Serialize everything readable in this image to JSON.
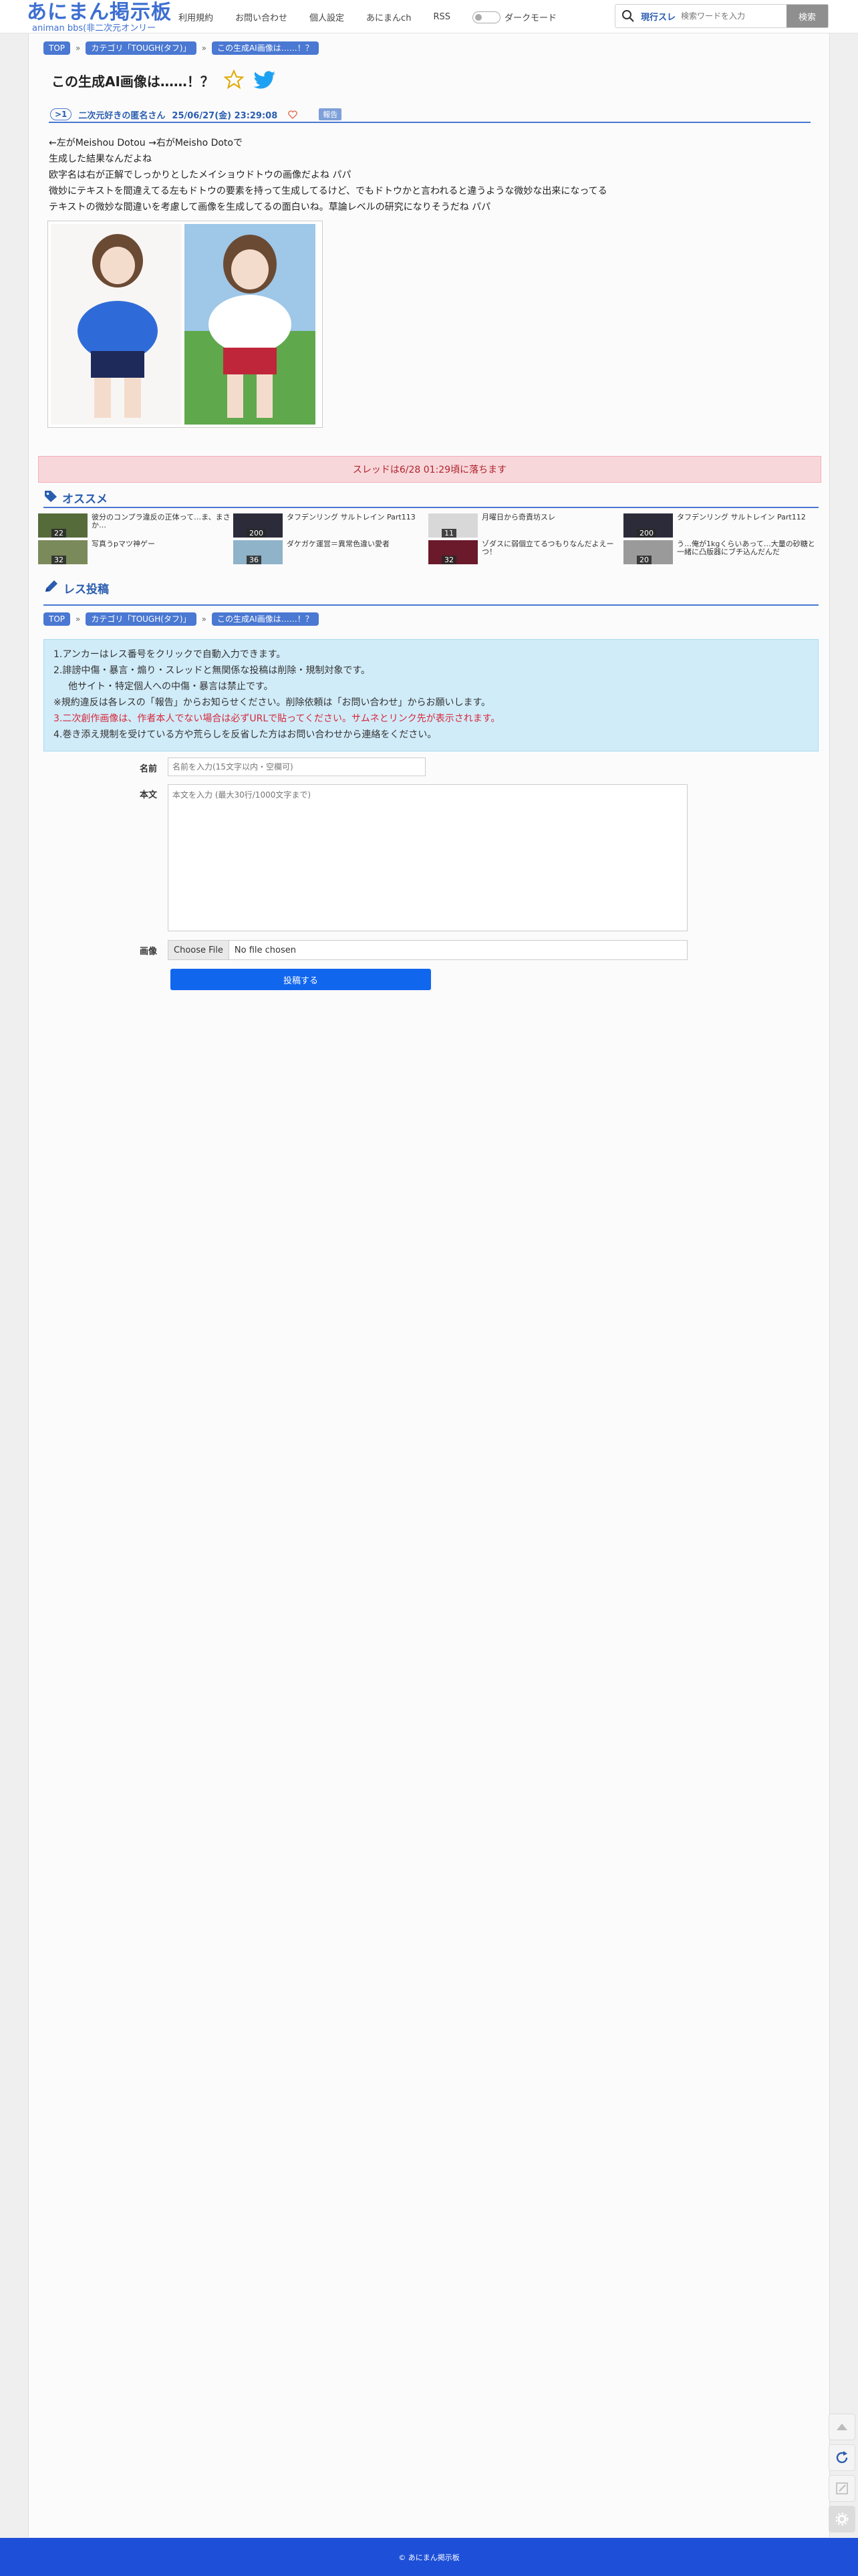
{
  "header": {
    "logo_main": "あにまん掲示板",
    "logo_sub": "animan bbs(非二次元オンリー",
    "nav": [
      "利用規約",
      "お問い合わせ",
      "個人設定",
      "あにまんch",
      "RSS"
    ],
    "dark_mode_label": "ダークモード",
    "search_scope": "現行スレ",
    "search_placeholder": "検索ワードを入力",
    "search_button": "検索"
  },
  "breadcrumb": [
    "TOP",
    "カテゴリ「TOUGH(タフ)」",
    "この生成AI画像は……！？"
  ],
  "thread": {
    "title": "この生成AI画像は……！？",
    "post": {
      "number": ">1",
      "poster": "二次元好きの匿名さん",
      "date": "25/06/27(金) 23:29:08",
      "report": "報告",
      "lines": [
        "←左がMeishou Dotou →右がMeisho Dotoで",
        "生成した結果なんだよね",
        "欧字名は右が正解でしっかりとしたメイショウドトウの画像だよね パパ",
        "微妙にテキストを間違えてる左もドトウの要素を持って生成してるけど、でもドトウかと言われると違うような微妙な出来になってる",
        "テキストの微妙な間違いを考慮して画像を生成してるの面白いね。草論レベルの研究になりそうだね パパ"
      ]
    },
    "alert": "スレッドは6/28 01:29頃に落ちます"
  },
  "recommend": {
    "title": "オススメ",
    "items": [
      {
        "text": "彼分のコンプラ違反の正体って…ま、まさか…",
        "count": "22"
      },
      {
        "text": "タフデンリング サルトレイン Part113",
        "count": "200"
      },
      {
        "text": "月曜日から奇責坊スレ",
        "count": "11"
      },
      {
        "text": "タフデンリング サルトレイン Part112",
        "count": "200"
      },
      {
        "text": "写真うpマツ神ゲー",
        "count": "32"
      },
      {
        "text": "ダケガケ運営＝異常色違い愛者",
        "count": "36"
      },
      {
        "text": "ゾダスに弱個立てるつもりなんだよえーつ！",
        "count": "32"
      },
      {
        "text": "う…俺が1kgくらいあって…大量の砂糖と一緒に凸版器にブチ込んだんだ",
        "count": "20"
      }
    ]
  },
  "reply": {
    "title": "レス投稿",
    "rules": [
      "1.アンカーはレス番号をクリックで自動入力できます。",
      "2.誹謗中傷・暴言・煽り・スレッドと無関係な投稿は削除・規制対象です。",
      "他サイト・特定個人への中傷・暴言は禁止です。",
      "※規約違反は各レスの「報告」からお知らせください。削除依頼は「お問い合わせ」からお願いします。",
      "3.二次創作画像は、作者本人でない場合は必ずURLで貼ってください。サムネとリンク先が表示されます。",
      "4.巻き添え規制を受けている方や荒らしを反省した方はお問い合わせから連絡をください。"
    ],
    "name_label": "名前",
    "name_placeholder": "名前を入力(15文字以内・空欄可)",
    "body_label": "本文",
    "body_placeholder": "本文を入力 (最大30行/1000文字まで)",
    "image_label": "画像",
    "file_button": "Choose File",
    "file_status": "No file chosen",
    "submit": "投稿する"
  },
  "footer": "© あにまん掲示板",
  "colors": {
    "accent": "#4a78d2",
    "footer": "#1d4fd8",
    "alert_bg": "#f8d7da",
    "info_bg": "#d1ecf9"
  }
}
